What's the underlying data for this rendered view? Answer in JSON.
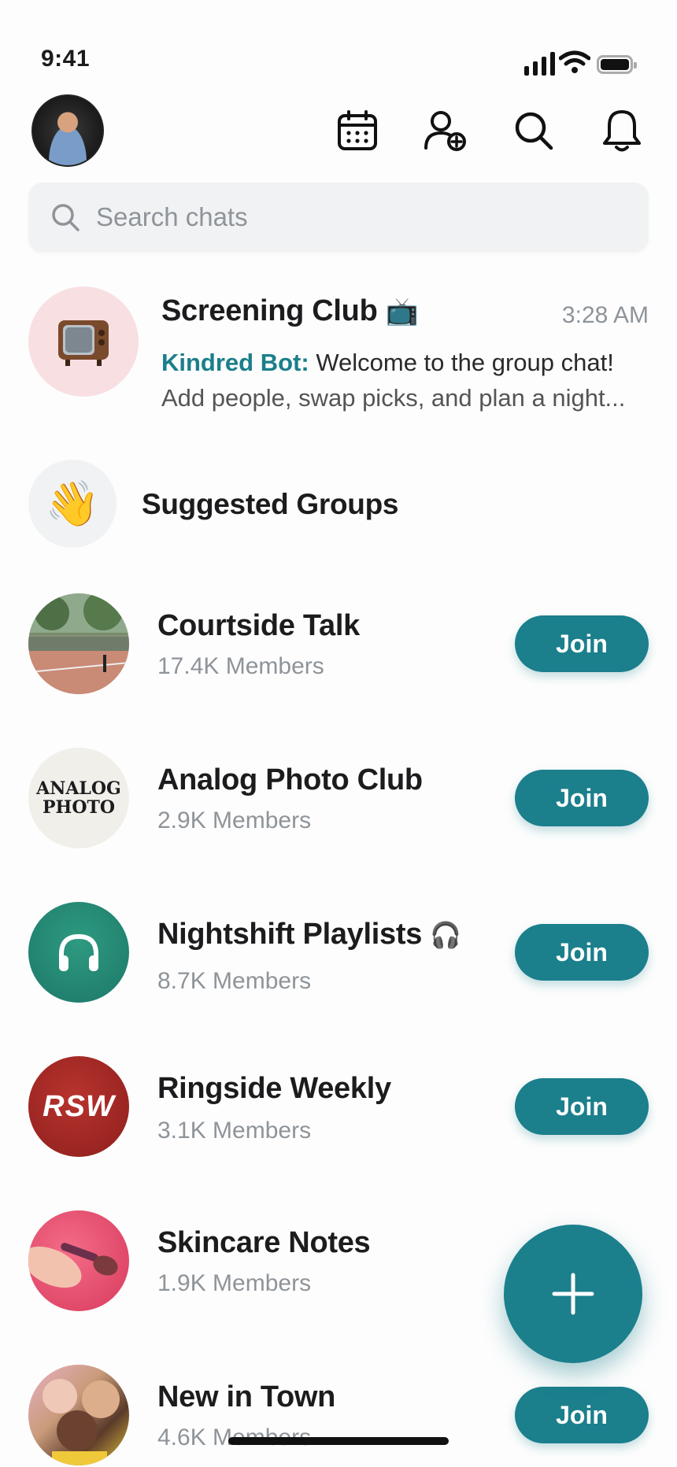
{
  "status_bar": {
    "time": "9:41"
  },
  "header": {
    "icons": [
      "calendar-icon",
      "add-friend-icon",
      "search-icon",
      "bell-icon"
    ]
  },
  "search": {
    "placeholder": "Search chats"
  },
  "chat": {
    "name": "Screening Club",
    "emoji": "📺",
    "time": "3:28 AM",
    "sender": "Kindred Bot:",
    "message_line1": " Welcome to the group chat!",
    "message_line2": "Add people, swap picks, and plan a night..."
  },
  "suggested": {
    "title": "Suggested Groups",
    "emoji": "👋"
  },
  "groups": [
    {
      "name": "Courtside Talk",
      "members": "17.4K Members",
      "join_label": "Join"
    },
    {
      "name": "Analog Photo Club",
      "members": "2.9K Members",
      "join_label": "Join",
      "avatar_text_1": "ANALOG",
      "avatar_text_2": "PHOTO"
    },
    {
      "name": "Nightshift Playlists",
      "emoji": "🎧",
      "members": "8.7K Members",
      "join_label": "Join"
    },
    {
      "name": "Ringside Weekly",
      "members": "3.1K Members",
      "join_label": "Join",
      "avatar_text": "RSW"
    },
    {
      "name": "Skincare Notes",
      "members": "1.9K Members"
    },
    {
      "name": "New in Town",
      "members": "4.6K Members",
      "join_label": "Join"
    }
  ],
  "colors": {
    "accent": "#1b7f8c",
    "sender": "#1a7f8a",
    "muted": "#8e9499"
  }
}
